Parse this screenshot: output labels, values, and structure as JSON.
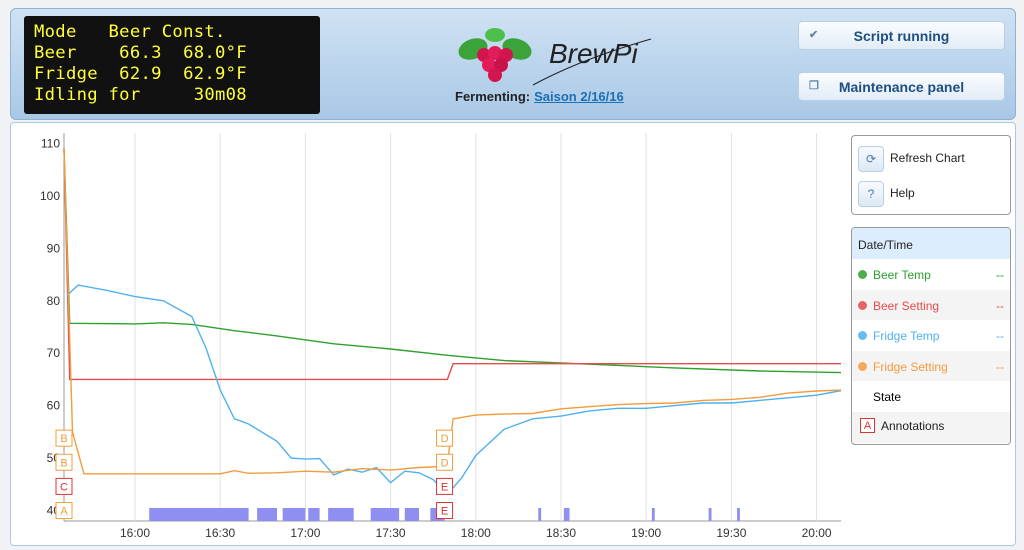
{
  "lcd": {
    "lines": [
      "Mode   Beer Const.",
      "Beer    66.3  68.0°F",
      "Fridge  62.9  62.9°F",
      "Idling for     30m08"
    ]
  },
  "logo": {
    "text": "BrewPi"
  },
  "status": {
    "label": "Fermenting:",
    "beer_name": "Saison 2/16/16"
  },
  "buttons": {
    "script": {
      "label": "Script running",
      "icon": "check-icon"
    },
    "maintenance": {
      "label": "Maintenance panel",
      "icon": "window-icon"
    }
  },
  "controls": {
    "refresh": {
      "label": "Refresh Chart",
      "icon": "refresh-icon"
    },
    "help": {
      "label": "Help",
      "icon": "?"
    }
  },
  "legend": {
    "header": "Date/Time",
    "items": [
      {
        "name": "Beer Temp",
        "value": "--",
        "color": "#2ea02e"
      },
      {
        "name": "Beer Setting",
        "value": "--",
        "color": "#e74c4c"
      },
      {
        "name": "Fridge Temp",
        "value": "--",
        "color": "#4eb1ee"
      },
      {
        "name": "Fridge Setting",
        "value": "--",
        "color": "#f39c3c"
      },
      {
        "name": "State",
        "value": "",
        "color": ""
      },
      {
        "name": "Annotations",
        "value": "",
        "color": "#d33",
        "marker": "A"
      }
    ]
  },
  "chart_data": {
    "type": "line",
    "ylim": [
      38,
      112
    ],
    "yticks": [
      40,
      50,
      60,
      70,
      80,
      90,
      100,
      110
    ],
    "xlim": [
      "15:35",
      "20:10"
    ],
    "xticks": [
      "16:00",
      "16:30",
      "17:00",
      "17:30",
      "18:00",
      "18:30",
      "19:00",
      "19:30",
      "20:00"
    ],
    "series": [
      {
        "name": "Beer Temp",
        "color": "#2ea02e",
        "x": [
          "15:35",
          "15:37",
          "16:00",
          "16:10",
          "16:20",
          "16:35",
          "16:50",
          "17:10",
          "17:30",
          "17:50",
          "18:10",
          "18:40",
          "19:10",
          "19:40",
          "20:10"
        ],
        "y": [
          109,
          75.7,
          75.6,
          75.8,
          75.5,
          74.3,
          73.3,
          71.8,
          70.8,
          69.6,
          68.6,
          67.9,
          67.2,
          66.6,
          66.3
        ]
      },
      {
        "name": "Beer Setting",
        "color": "#e74c4c",
        "x": [
          "15:35",
          "15:37",
          "17:50",
          "17:52",
          "20:10"
        ],
        "y": [
          109,
          65,
          65,
          68,
          68
        ]
      },
      {
        "name": "Fridge Temp",
        "color": "#4eb1ee",
        "x": [
          "15:36",
          "15:40",
          "15:50",
          "16:00",
          "16:10",
          "16:20",
          "16:25",
          "16:30",
          "16:35",
          "16:40",
          "16:50",
          "16:55",
          "17:00",
          "17:05",
          "17:10",
          "17:15",
          "17:20",
          "17:25",
          "17:30",
          "17:35",
          "17:40",
          "17:45",
          "17:50",
          "17:55",
          "18:00",
          "18:10",
          "18:20",
          "18:30",
          "18:40",
          "18:50",
          "19:00",
          "19:10",
          "19:20",
          "19:30",
          "19:40",
          "19:50",
          "20:00",
          "20:10"
        ],
        "y": [
          81,
          83,
          82,
          80.8,
          80,
          77,
          71,
          63,
          57.5,
          56.5,
          53.2,
          50,
          49.8,
          49.9,
          46.8,
          47.9,
          47.3,
          48.2,
          45.3,
          47.5,
          47.2,
          45.9,
          43.1,
          46.2,
          50.5,
          55.5,
          57.5,
          58,
          59,
          59.5,
          59.5,
          60,
          60.5,
          60.5,
          61,
          61.5,
          62,
          63
        ]
      },
      {
        "name": "Fridge Setting",
        "color": "#f39c3c",
        "x": [
          "15:35",
          "15:38",
          "15:42",
          "16:30",
          "16:35",
          "16:40",
          "16:50",
          "17:00",
          "17:10",
          "17:20",
          "17:30",
          "17:40",
          "17:48",
          "17:50",
          "17:52",
          "18:00",
          "18:10",
          "18:20",
          "18:30",
          "18:40",
          "18:50",
          "19:00",
          "19:10",
          "19:20",
          "19:30",
          "19:40",
          "19:50",
          "20:00",
          "20:10"
        ],
        "y": [
          109,
          55,
          47,
          47,
          47.6,
          47.1,
          47.2,
          47.5,
          47.3,
          48,
          47.7,
          48.2,
          48.4,
          49,
          57.5,
          58.2,
          58.4,
          58.5,
          59.4,
          59.8,
          60.2,
          60.4,
          60.5,
          61,
          61.2,
          61.6,
          62.4,
          62.8,
          63
        ]
      }
    ],
    "state_blocks": [
      [
        "16:05",
        "16:40"
      ],
      [
        "16:43",
        "16:50"
      ],
      [
        "16:52",
        "17:00"
      ],
      [
        "17:01",
        "17:05"
      ],
      [
        "17:08",
        "17:17"
      ],
      [
        "17:23",
        "17:33"
      ],
      [
        "17:35",
        "17:40"
      ],
      [
        "17:44",
        "17:49"
      ],
      [
        "18:22",
        "18:23"
      ],
      [
        "18:31",
        "18:33"
      ],
      [
        "19:02",
        "19:03"
      ],
      [
        "19:22",
        "19:23"
      ],
      [
        "19:32",
        "19:33"
      ]
    ],
    "annotations": [
      {
        "label": "B",
        "x": "15:35",
        "y": 53.8,
        "color": "#f39c3c"
      },
      {
        "label": "B",
        "x": "15:35",
        "y": 49.2,
        "color": "#f39c3c"
      },
      {
        "label": "C",
        "x": "15:35",
        "y": 44.6,
        "color": "#d33"
      },
      {
        "label": "A",
        "x": "15:35",
        "y": 40,
        "color": "#f39c3c"
      },
      {
        "label": "D",
        "x": "17:49",
        "y": 53.8,
        "color": "#f39c3c"
      },
      {
        "label": "D",
        "x": "17:49",
        "y": 49.2,
        "color": "#f39c3c"
      },
      {
        "label": "E",
        "x": "17:49",
        "y": 44.6,
        "color": "#d33"
      },
      {
        "label": "E",
        "x": "17:49",
        "y": 40,
        "color": "#d33"
      }
    ]
  }
}
